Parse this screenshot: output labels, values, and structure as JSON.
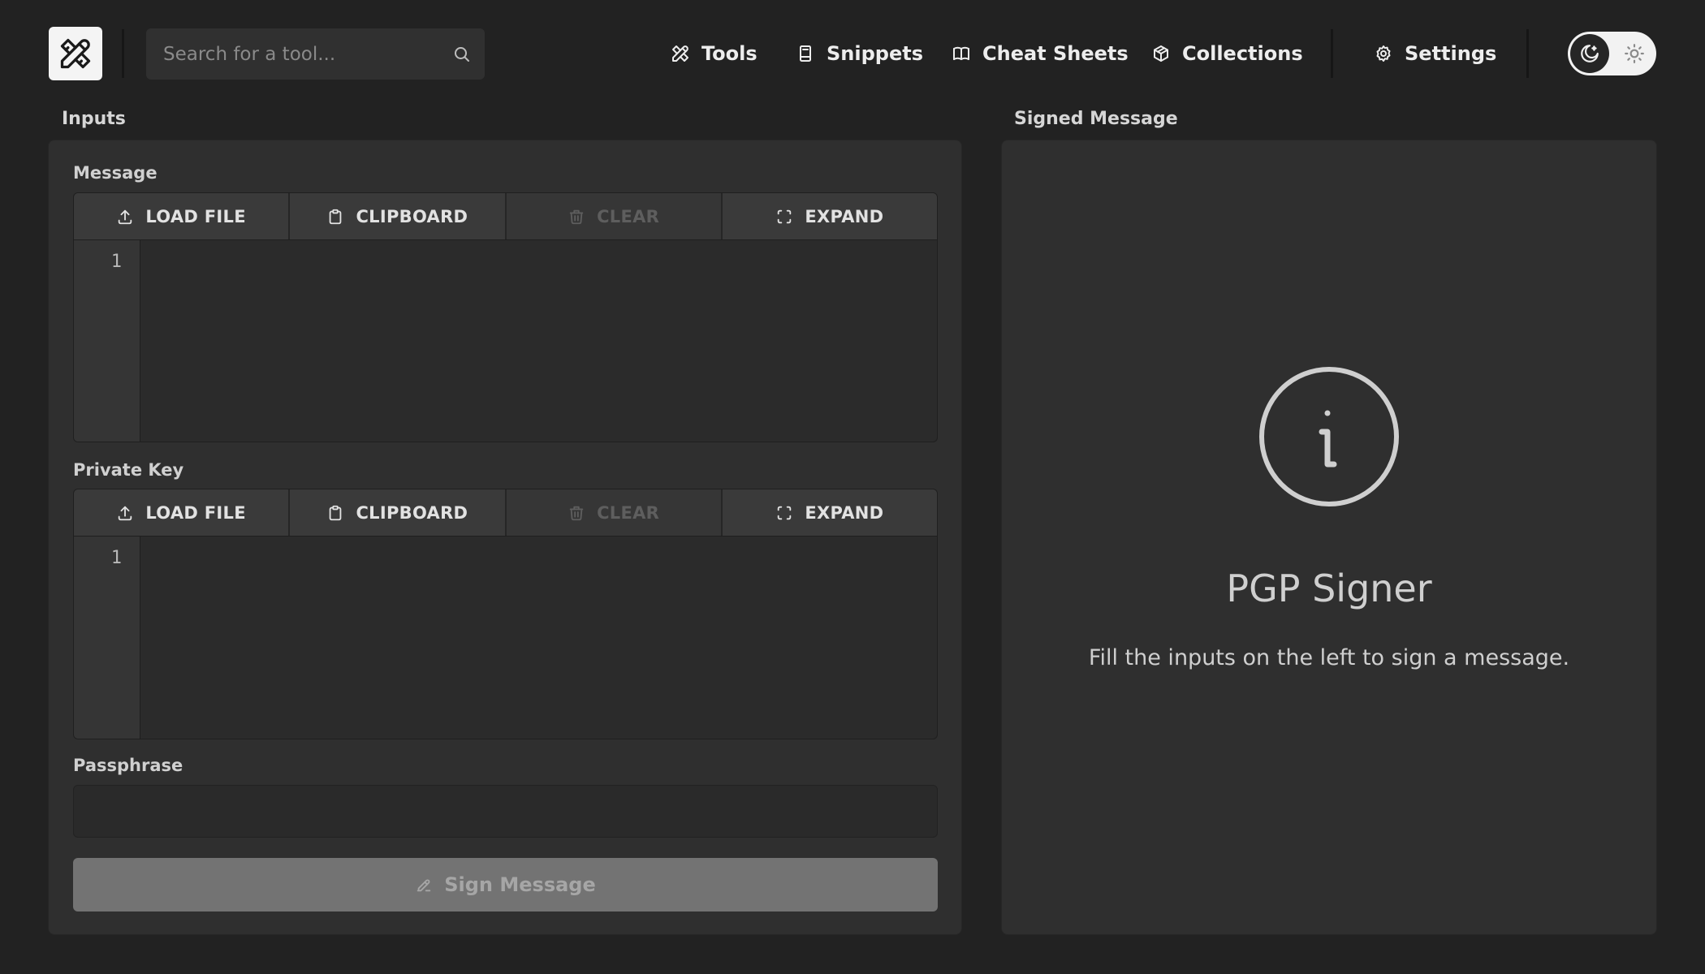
{
  "header": {
    "search_placeholder": "Search for a tool...",
    "nav": [
      {
        "label": "Tools",
        "icon": "tools-icon"
      },
      {
        "label": "Snippets",
        "icon": "snippets-icon"
      },
      {
        "label": "Cheat Sheets",
        "icon": "book-icon"
      },
      {
        "label": "Collections",
        "icon": "box-icon"
      }
    ],
    "settings_label": "Settings",
    "theme": {
      "active": "dark",
      "icons": [
        "moon-icon",
        "sun-icon"
      ]
    }
  },
  "inputs": {
    "section_title": "Inputs",
    "message": {
      "label": "Message",
      "toolbar": {
        "load": "LOAD FILE",
        "clipboard": "CLIPBOARD",
        "clear": "CLEAR",
        "expand": "EXPAND"
      },
      "line_number": "1",
      "value": ""
    },
    "private_key": {
      "label": "Private Key",
      "toolbar": {
        "load": "LOAD FILE",
        "clipboard": "CLIPBOARD",
        "clear": "CLEAR",
        "expand": "EXPAND"
      },
      "line_number": "1",
      "value": ""
    },
    "passphrase": {
      "label": "Passphrase",
      "value": ""
    },
    "sign_button": "Sign Message"
  },
  "output": {
    "section_title": "Signed Message",
    "empty_title": "PGP Signer",
    "empty_description": "Fill the inputs on the left to sign a message."
  },
  "colors": {
    "background": "#222222",
    "panel": "#2f2f2f",
    "toolbar_button": "#3a3a3a",
    "disabled_button": "#737373"
  }
}
